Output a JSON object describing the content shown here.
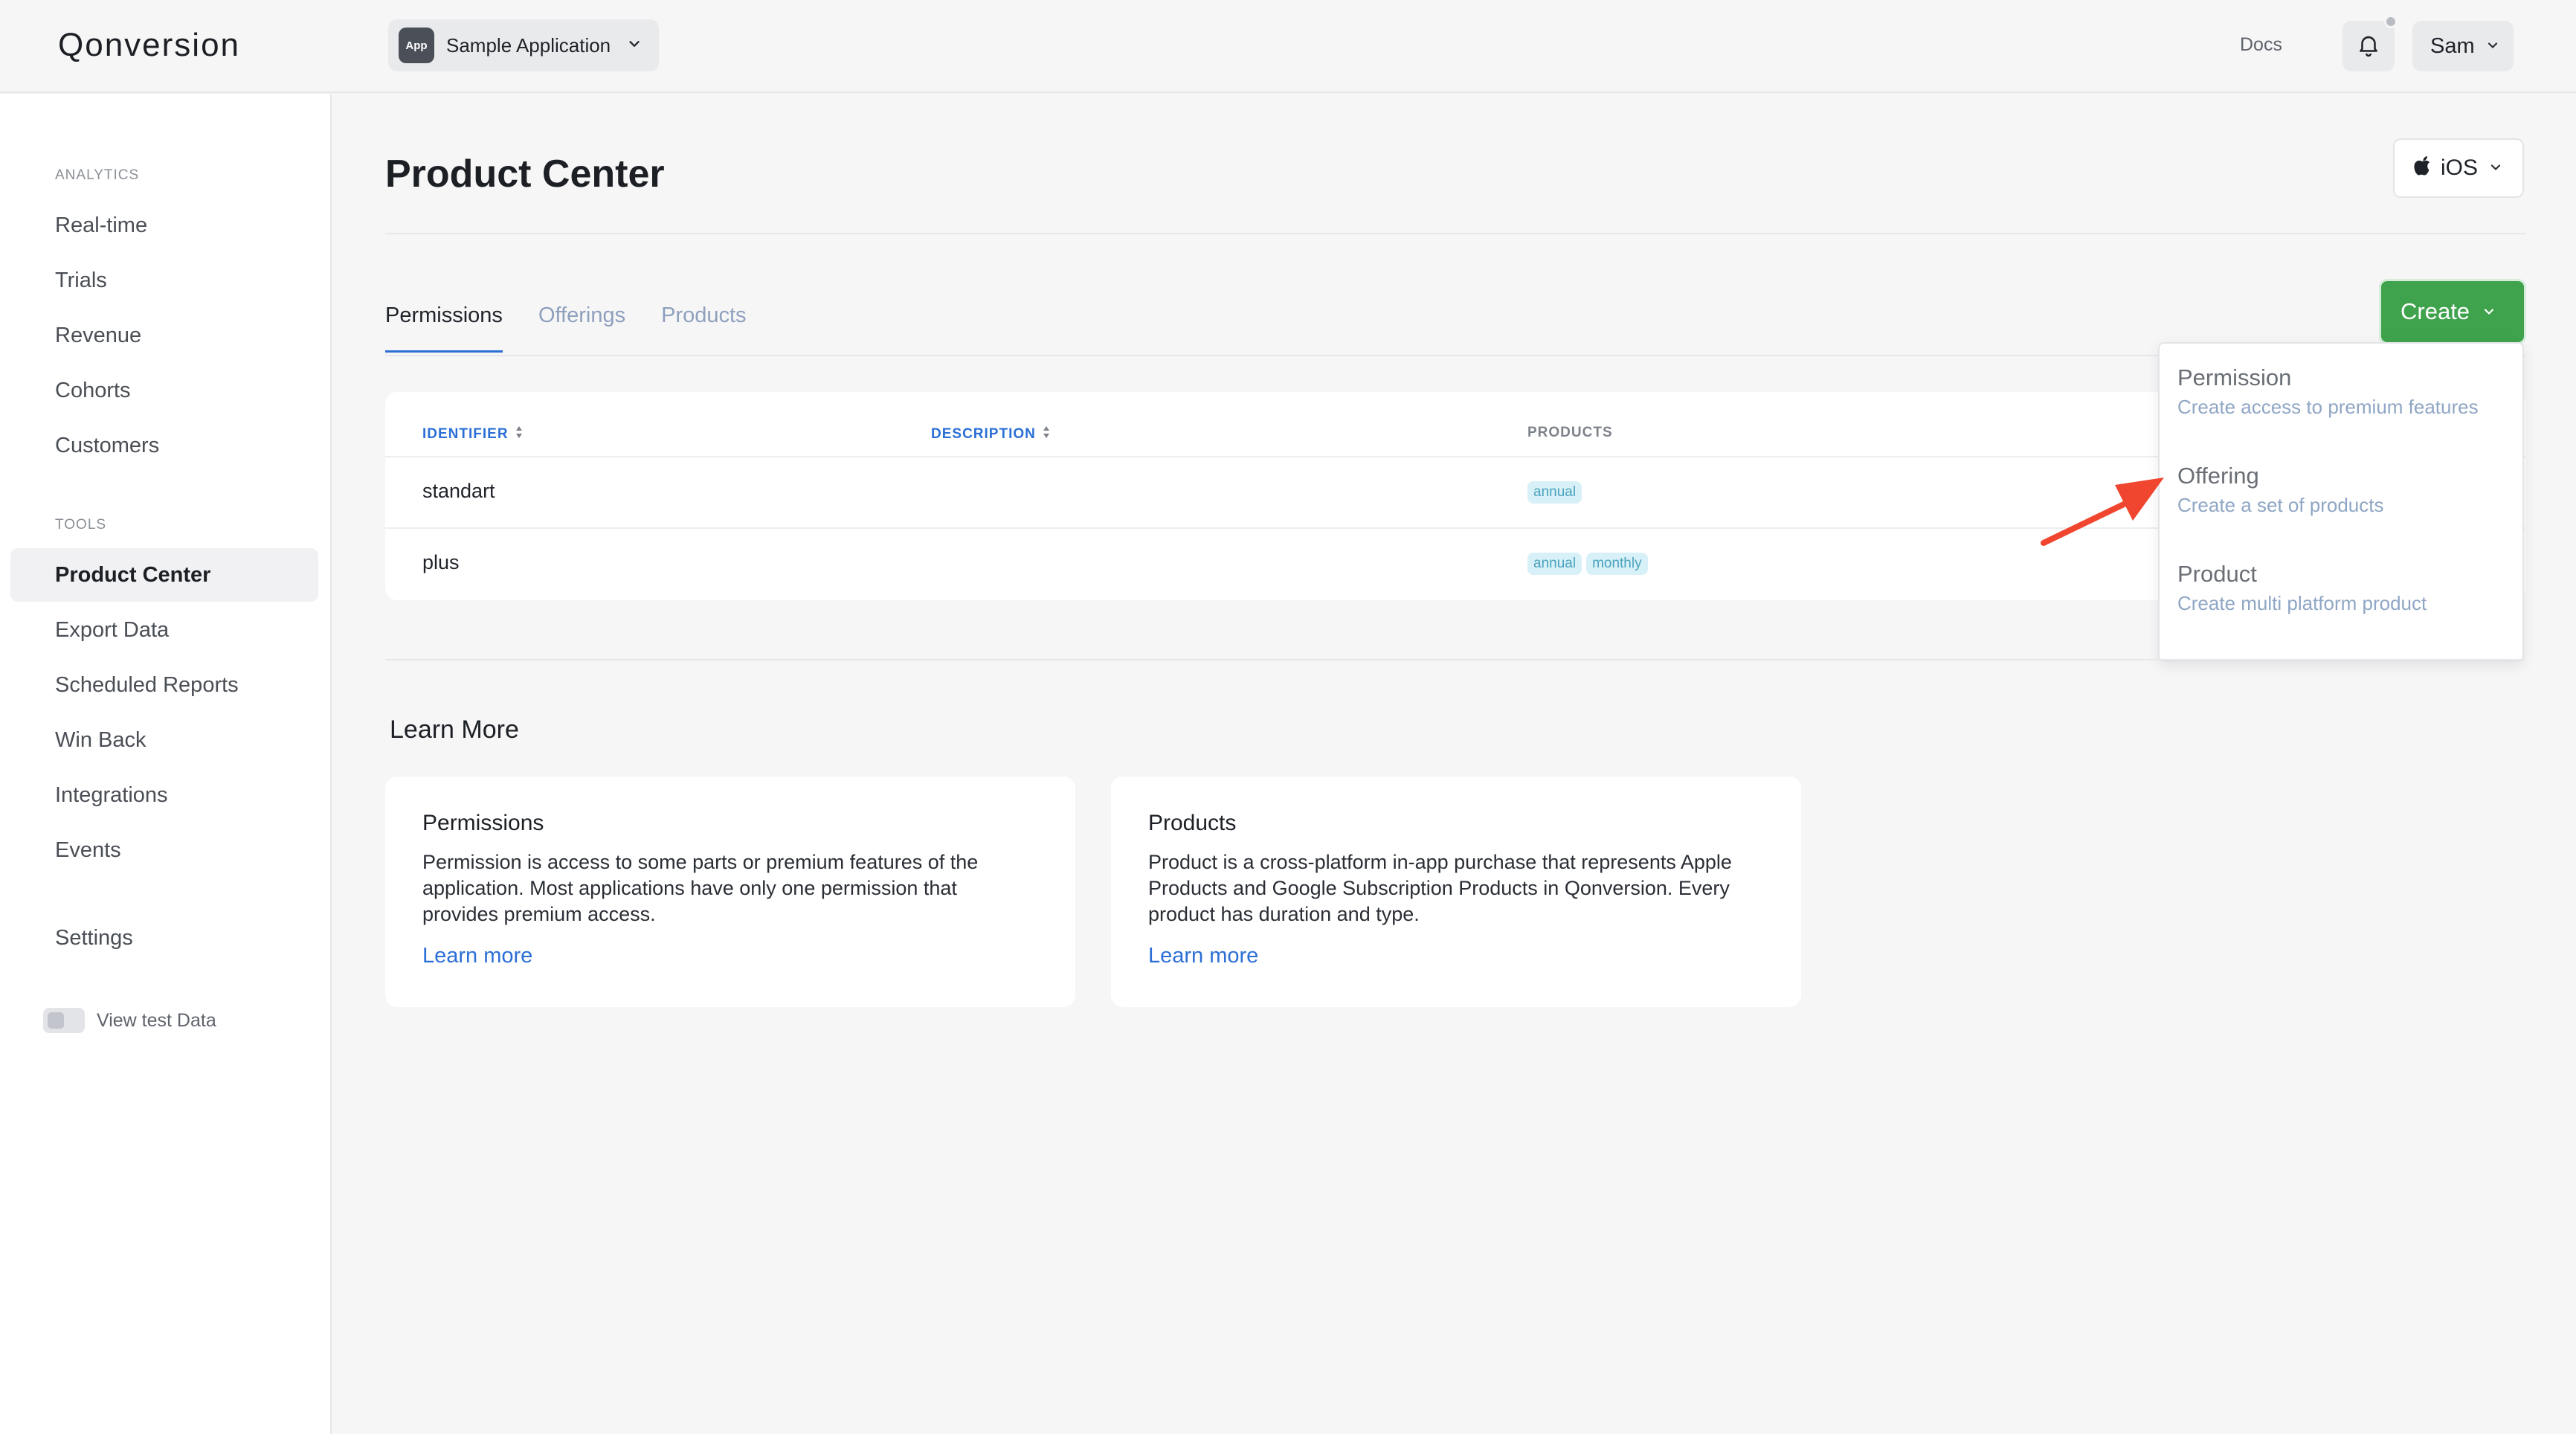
{
  "topbar": {
    "logo": "Qonversion",
    "app_badge": "App",
    "app_name": "Sample Application",
    "docs": "Docs",
    "user": "Sam"
  },
  "sidebar": {
    "analytics_label": "ANALYTICS",
    "analytics_items": [
      "Real-time",
      "Trials",
      "Revenue",
      "Cohorts",
      "Customers"
    ],
    "tools_label": "TOOLS",
    "tools_items": [
      "Product Center",
      "Export Data",
      "Scheduled Reports",
      "Win Back",
      "Integrations",
      "Events"
    ],
    "settings": "Settings",
    "test_data_label": "View test Data",
    "active_item": "Product Center"
  },
  "main": {
    "title": "Product Center",
    "platform": "iOS",
    "tabs": [
      "Permissions",
      "Offerings",
      "Products"
    ],
    "active_tab": "Permissions",
    "create_label": "Create",
    "table": {
      "headers": [
        "IDENTIFIER",
        "DESCRIPTION",
        "PRODUCTS"
      ],
      "rows": [
        {
          "identifier": "standart",
          "description": "",
          "products": [
            "annual"
          ]
        },
        {
          "identifier": "plus",
          "description": "",
          "products": [
            "annual",
            "monthly"
          ]
        }
      ]
    },
    "dropdown": [
      {
        "title": "Permission",
        "desc": "Create access to premium features"
      },
      {
        "title": "Offering",
        "desc": "Create a set of products"
      },
      {
        "title": "Product",
        "desc": "Create multi platform product"
      }
    ],
    "learn_more": {
      "title": "Learn More",
      "cards": [
        {
          "title": "Permissions",
          "text": "Permission is access to some parts or premium features of the application. Most applications have only one permission that provides premium access.",
          "link": "Learn more"
        },
        {
          "title": "Products",
          "text": "Product is a cross-platform in-app purchase that represents Apple Products and Google Subscription Products in Qonversion. Every product has duration and type.",
          "link": "Learn more"
        }
      ]
    }
  },
  "colors": {
    "accent_blue": "#2b6fd6",
    "create_green": "#3fa34d",
    "annotation_arrow": "#f0452e"
  }
}
